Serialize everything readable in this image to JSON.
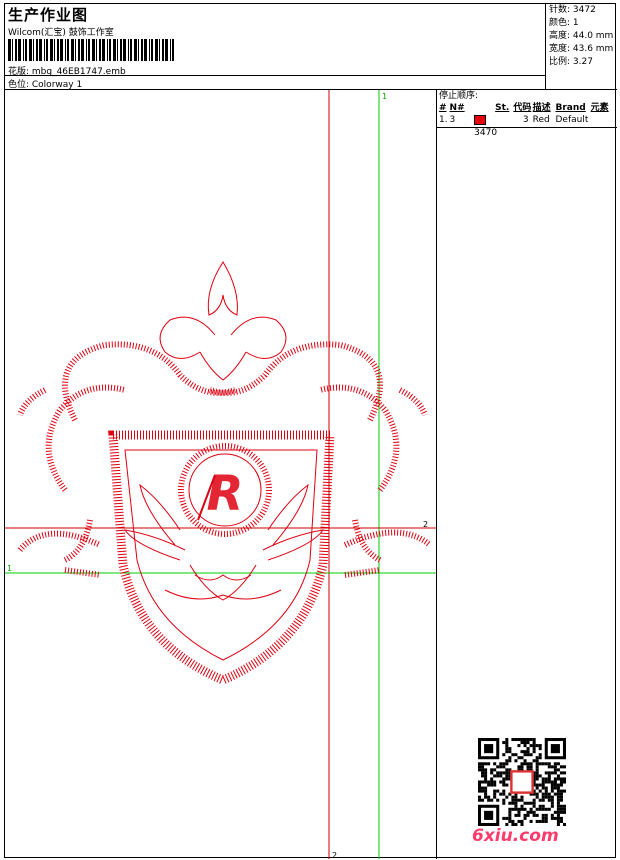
{
  "header": {
    "title": "生产作业图",
    "company": "Wilcom(汇宝) 鼓饰工作室",
    "filename": "花版: mbg_46EB1747.emb",
    "colorway": "色位: Colorway 1"
  },
  "stats": {
    "stitches": "针数: 3472",
    "colors": "颜色: 1",
    "height": "高度: 44.0 mm",
    "width": "宽度: 43.6 mm",
    "scale": "比例: 3.27"
  },
  "stop_sequence": {
    "caption": "停止顺序:",
    "headers": [
      "#",
      "N#",
      "St.",
      "代码",
      "描述",
      "Brand",
      "元素"
    ],
    "rows": [
      {
        "index": "1.",
        "needle": "3",
        "color": "#e8000b",
        "stitches": "3470",
        "code": "3",
        "desc": "Red",
        "brand": "Default",
        "element": ""
      }
    ]
  },
  "guides": {
    "labels": [
      "1",
      "2",
      "2",
      "1"
    ]
  },
  "watermark": "6xiu.com",
  "colors": {
    "design": "#e00010",
    "guide_green": "#00cc00",
    "guide_red": "#cc0000"
  }
}
